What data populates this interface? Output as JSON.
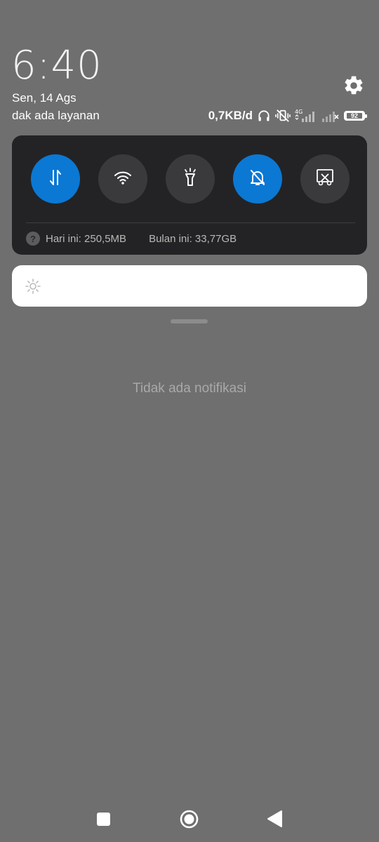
{
  "status": {
    "time": "6:40",
    "date": "Sen, 14 Ags",
    "carrier": "dak ada layanan",
    "net_speed": "0,7KB/d",
    "network_type": "4G",
    "battery": "92",
    "icons": [
      "headphones-icon",
      "vibrate-off-icon",
      "signal-4g-icon",
      "signal-no-service-icon",
      "battery-icon"
    ]
  },
  "quick_settings": {
    "toggles": [
      {
        "name": "mobile-data",
        "icon": "data-arrows-icon",
        "active": true
      },
      {
        "name": "wifi",
        "icon": "wifi-icon",
        "active": false
      },
      {
        "name": "flashlight",
        "icon": "flashlight-icon",
        "active": false
      },
      {
        "name": "silent",
        "icon": "bell-off-icon",
        "active": true
      },
      {
        "name": "screenshot",
        "icon": "scissors-icon",
        "active": false
      }
    ],
    "usage_today": "Hari ini: 250,5MB",
    "usage_month": "Bulan ini: 33,77GB"
  },
  "notifications": {
    "empty_text": "Tidak ada notifikasi"
  },
  "colors": {
    "background": "#6f6f6f",
    "panel": "#232325",
    "accent": "#0b78d4",
    "toggle_off": "#3a3a3c"
  }
}
